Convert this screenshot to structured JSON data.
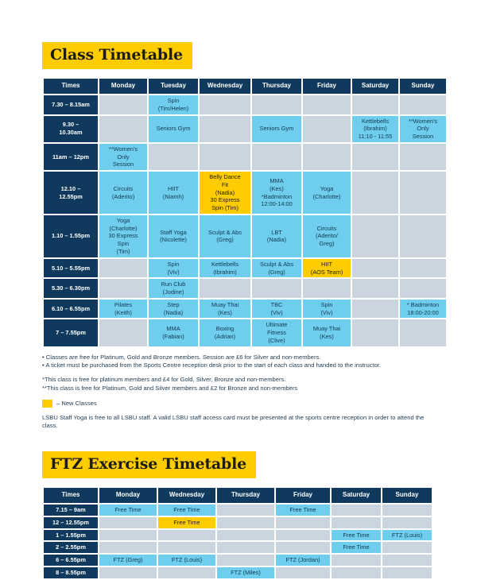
{
  "class_timetable": {
    "title": "Class Timetable",
    "columns": [
      "Times",
      "Monday",
      "Tuesday",
      "Wednesday",
      "Thursday",
      "Friday",
      "Saturday",
      "Sunday"
    ],
    "rows": [
      {
        "time": "7.30 – 8.15am",
        "cells": [
          {
            "text": "",
            "style": "empty"
          },
          {
            "text": "Spin\n(Tim/Helen)",
            "style": "blue"
          },
          {
            "text": "",
            "style": "empty"
          },
          {
            "text": "",
            "style": "empty"
          },
          {
            "text": "",
            "style": "empty"
          },
          {
            "text": "",
            "style": "empty"
          },
          {
            "text": "",
            "style": "empty"
          }
        ]
      },
      {
        "time": "9.30 –\n10.30am",
        "cells": [
          {
            "text": "",
            "style": "empty"
          },
          {
            "text": "Seniors Gym",
            "style": "blue"
          },
          {
            "text": "",
            "style": "empty"
          },
          {
            "text": "Seniors Gym",
            "style": "blue"
          },
          {
            "text": "",
            "style": "empty"
          },
          {
            "text": "Kettlebells\n(Ibrahim)\n11:10 - 11:55",
            "style": "blue"
          },
          {
            "text": "**Women's\nOnly\nSession",
            "style": "blue"
          }
        ]
      },
      {
        "time": "11am – 12pm",
        "cells": [
          {
            "text": "**Women's\nOnly\nSession",
            "style": "blue"
          },
          {
            "text": "",
            "style": "empty"
          },
          {
            "text": "",
            "style": "empty"
          },
          {
            "text": "",
            "style": "empty"
          },
          {
            "text": "",
            "style": "empty"
          },
          {
            "text": "",
            "style": "empty"
          },
          {
            "text": "",
            "style": "empty"
          }
        ]
      },
      {
        "time": "12.10 –\n12.55pm",
        "cells": [
          {
            "text": "Circuits\n(Aderito)",
            "style": "blue"
          },
          {
            "text": "HIIT\n(Niamh)",
            "style": "blue"
          },
          {
            "text": "Belly Dance\nFit\n(Nadia)\n30 Express\nSpin (Tim)",
            "style": "yellow"
          },
          {
            "text": "MMA\n(Kes)\n*Badminton\n12:00-14:00",
            "style": "blue"
          },
          {
            "text": "Yoga\n(Charlotte)",
            "style": "blue"
          },
          {
            "text": "",
            "style": "empty"
          },
          {
            "text": "",
            "style": "empty"
          }
        ]
      },
      {
        "time": "1.10 – 1.55pm",
        "cells": [
          {
            "text": "Yoga\n(Charlotte)\n30 Express\nSpin\n(Tim)",
            "style": "blue"
          },
          {
            "text": "Staff Yoga\n(Nicolette)",
            "style": "blue"
          },
          {
            "text": "Sculpt & Abs\n(Greg)",
            "style": "blue"
          },
          {
            "text": "LBT\n(Nadia)",
            "style": "blue"
          },
          {
            "text": "Circuits\n(Aderito/\nGreg)",
            "style": "blue"
          },
          {
            "text": "",
            "style": "empty"
          },
          {
            "text": "",
            "style": "empty"
          }
        ]
      },
      {
        "time": "5.10 – 5.55pm",
        "cells": [
          {
            "text": "",
            "style": "empty"
          },
          {
            "text": "Spin\n(Viv)",
            "style": "blue"
          },
          {
            "text": "Kettlebells\n(Ibrahim)",
            "style": "blue"
          },
          {
            "text": "Sculpt & Abs\n(Greg)",
            "style": "blue"
          },
          {
            "text": "HIIT\n(AOS Team)",
            "style": "yellow"
          },
          {
            "text": "",
            "style": "empty"
          },
          {
            "text": "",
            "style": "empty"
          }
        ]
      },
      {
        "time": "5.30 – 6.30pm",
        "cells": [
          {
            "text": "",
            "style": "empty"
          },
          {
            "text": "Run Club\n(Jodine)",
            "style": "blue"
          },
          {
            "text": "",
            "style": "empty"
          },
          {
            "text": "",
            "style": "empty"
          },
          {
            "text": "",
            "style": "empty"
          },
          {
            "text": "",
            "style": "empty"
          },
          {
            "text": "",
            "style": "empty"
          }
        ]
      },
      {
        "time": "6.10 – 6.55pm",
        "cells": [
          {
            "text": "Pilates\n(Keith)",
            "style": "blue"
          },
          {
            "text": "Step\n(Nadia)",
            "style": "blue"
          },
          {
            "text": "Muay Thai\n(Kes)",
            "style": "blue"
          },
          {
            "text": "TBC\n(Viv)",
            "style": "blue"
          },
          {
            "text": "Spin\n(Viv)",
            "style": "blue"
          },
          {
            "text": "",
            "style": "empty"
          },
          {
            "text": "* Badminton\n18:00-20:00",
            "style": "blue"
          }
        ]
      },
      {
        "time": "7 – 7.55pm",
        "cells": [
          {
            "text": "",
            "style": "empty"
          },
          {
            "text": "MMA\n(Fabian)",
            "style": "blue"
          },
          {
            "text": "Boxing\n(Adrian)",
            "style": "blue"
          },
          {
            "text": "Ultimate\nFitness\n(Clive)",
            "style": "blue"
          },
          {
            "text": "Muay Thai\n(Kes)",
            "style": "blue"
          },
          {
            "text": "",
            "style": "empty"
          },
          {
            "text": "",
            "style": "empty"
          }
        ]
      }
    ]
  },
  "notes": {
    "bullet_1": "• Classes are free for Platinum, Gold and Bronze members. Session are £6 for Silver and non-members.",
    "bullet_2": "• A ticket must be purchased from the Sports Centre reception desk prior to the start of each class and handed to the instructor.",
    "single_star": "*This class is free for platinum members and £4 for Gold, Silver, Bronze and non-members.",
    "double_star": "**This class is free for Platinum, Gold and Silver members and £2 for Bronze and non-members",
    "legend_label": "– New Classes",
    "staff_yoga": "LSBU Staff Yoga is free to all LSBU staff. A valid LSBU staff access card must be presented at the sports centre reception in order to attend the class."
  },
  "ftz_timetable": {
    "title": "FTZ Exercise Timetable",
    "columns": [
      "Times",
      "Monday",
      "Wednesday",
      "Thursday",
      "Friday",
      "Saturday",
      "Sunday"
    ],
    "rows": [
      {
        "time": "7.15 – 9am",
        "cells": [
          {
            "text": "Free Time",
            "style": "blue"
          },
          {
            "text": "Free Time",
            "style": "blue"
          },
          {
            "text": "",
            "style": "empty"
          },
          {
            "text": "Free Time",
            "style": "blue"
          },
          {
            "text": "",
            "style": "empty"
          },
          {
            "text": "",
            "style": "empty"
          }
        ]
      },
      {
        "time": "12 – 12.55pm",
        "cells": [
          {
            "text": "",
            "style": "empty"
          },
          {
            "text": "Free Time",
            "style": "yellow"
          },
          {
            "text": "",
            "style": "empty"
          },
          {
            "text": "",
            "style": "empty"
          },
          {
            "text": "",
            "style": "empty"
          },
          {
            "text": "",
            "style": "empty"
          }
        ]
      },
      {
        "time": "1 – 1.55pm",
        "cells": [
          {
            "text": "",
            "style": "empty"
          },
          {
            "text": "",
            "style": "empty"
          },
          {
            "text": "",
            "style": "empty"
          },
          {
            "text": "",
            "style": "empty"
          },
          {
            "text": "Free Time",
            "style": "blue"
          },
          {
            "text": "FTZ (Louis)",
            "style": "blue"
          }
        ]
      },
      {
        "time": "2 – 2.55pm",
        "cells": [
          {
            "text": "",
            "style": "empty"
          },
          {
            "text": "",
            "style": "empty"
          },
          {
            "text": "",
            "style": "empty"
          },
          {
            "text": "",
            "style": "empty"
          },
          {
            "text": "Free Time",
            "style": "blue"
          },
          {
            "text": "",
            "style": "empty"
          }
        ]
      },
      {
        "time": "6 – 6.55pm",
        "cells": [
          {
            "text": "FTZ (Greg)",
            "style": "blue"
          },
          {
            "text": "FTZ (Louis)",
            "style": "blue"
          },
          {
            "text": "",
            "style": "empty"
          },
          {
            "text": "FTZ (Jordan)",
            "style": "blue"
          },
          {
            "text": "",
            "style": "empty"
          },
          {
            "text": "",
            "style": "empty"
          }
        ]
      },
      {
        "time": "8 – 8.55pm",
        "cells": [
          {
            "text": "",
            "style": "empty"
          },
          {
            "text": "",
            "style": "empty"
          },
          {
            "text": "FTZ (Miles)",
            "style": "blue"
          },
          {
            "text": "",
            "style": "empty"
          },
          {
            "text": "",
            "style": "empty"
          },
          {
            "text": "",
            "style": "empty"
          }
        ]
      }
    ]
  },
  "colors": {
    "header_navy": "#103A5D",
    "cell_blue": "#6FCDEE",
    "cell_empty": "#CBD5DF",
    "highlight_yellow": "#FFCC00"
  }
}
